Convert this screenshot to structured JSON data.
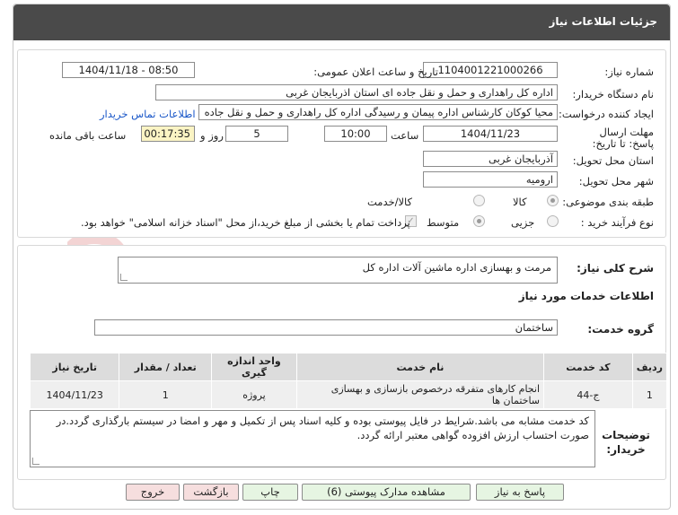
{
  "header": {
    "title": "جزئیات اطلاعات نیاز"
  },
  "fields": {
    "need_number_label": "شماره نیاز:",
    "need_number": "1104001221000266",
    "announce_label": "تاریخ و ساعت اعلان عمومی:",
    "announce_value": "1404/11/18 - 08:50",
    "buyer_org_label": "نام دستگاه خریدار:",
    "buyer_org": "اداره کل راهداری و حمل و نقل جاده ای استان اذربایجان غربی",
    "creator_label": "ایجاد کننده درخواست:",
    "creator": "محیا کوکان کارشناس اداره پیمان و رسیدگی اداره کل راهداری و حمل و نقل جاده",
    "contact_link": "اطلاعات تماس خریدار",
    "deadline_label": "مهلت ارسال پاسخ: تا تاریخ:",
    "deadline_date": "1404/11/23",
    "time_label": "ساعت",
    "deadline_time": "10:00",
    "days_value": "5",
    "days_label": "روز و",
    "remaining_time": "00:17:35",
    "remaining_label": "ساعت باقی مانده",
    "province_label": "استان محل تحویل:",
    "province": "آذربایجان غربی",
    "city_label": "شهر محل تحویل:",
    "city": "ارومیه",
    "category_label": "طبقه بندی موضوعی:",
    "category_options": [
      "کالا",
      "کالا/خدمت"
    ],
    "process_label": "نوع فرآیند خرید :",
    "process_options": [
      "جزیی",
      "متوسط"
    ],
    "payment_note": "پرداخت تمام یا بخشی از مبلغ خرید،از محل \"اسناد خزانه اسلامی\" خواهد بود."
  },
  "summary": {
    "label": "شرح کلی نیاز:",
    "value": "مرمت و بهسازی اداره ماشین آلات اداره کل"
  },
  "services": {
    "title": "اطلاعات خدمات مورد نیاز",
    "group_label": "گروه خدمت:",
    "group_value": "ساختمان",
    "columns": [
      "ردیف",
      "کد خدمت",
      "نام خدمت",
      "واحد اندازه گیری",
      "تعداد / مقدار",
      "تاریخ نیاز"
    ],
    "rows": [
      {
        "row": "1",
        "code": "ج-44",
        "name": "انجام کارهای متفرقه درخصوص بازسازی و بهسازی ساختمان ها",
        "unit": "پروژه",
        "qty": "1",
        "date": "1404/11/23"
      }
    ]
  },
  "buyer_notes": {
    "label": "توضیحات خریدار:",
    "value": "کد خدمت مشابه می باشد.شرایط در فایل پیوستی بوده و کلیه اسناد پس از تکمیل و مهر و امضا در سیستم بارگذاری گردد.در صورت احتساب ارزش افزوده گواهی معتبر ارائه گردد."
  },
  "buttons": {
    "reply": "پاسخ به نیاز",
    "attachments": "مشاهده مدارک پیوستی (6)",
    "print": "چاپ",
    "back": "بازگشت",
    "exit": "خروج"
  },
  "watermark": {
    "text": "AriaTender.neT"
  }
}
